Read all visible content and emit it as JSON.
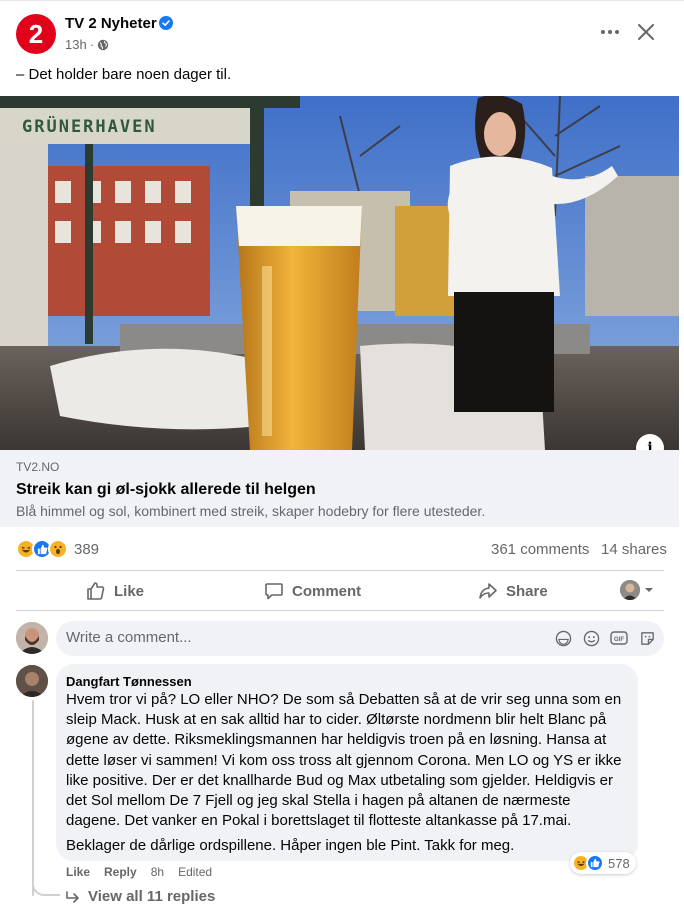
{
  "post": {
    "page_name": "TV 2 Nyheter",
    "logo_text": "2",
    "time": "13h",
    "meta_separator": "·",
    "text": "– Det holder bare noen dager til.",
    "image": {
      "sign_text": "GRÜNERHAVEN"
    },
    "link": {
      "domain": "TV2.NO",
      "title": "Streik kan gi øl-sjokk allerede til helgen",
      "description": "Blå himmel og sol, kombinert med streik, skaper hodebry for flere utesteder."
    },
    "reactions": {
      "types": [
        "haha-icon",
        "like-icon",
        "wow-icon"
      ],
      "count": "389",
      "comments": "361 comments",
      "shares": "14 shares"
    },
    "actions": {
      "like": "Like",
      "comment": "Comment",
      "share": "Share"
    }
  },
  "composer": {
    "placeholder": "Write a comment..."
  },
  "comment": {
    "author": "Dangfart Tønnessen",
    "body": "Hvem tror vi på? LO eller NHO? De som så Debatten så at de vrir seg unna som en sleip Mack. Husk at en sak alltid har to cider. Øltørste nordmenn blir helt Blanc på øgene av dette. Riksmeklingsmannen har heldigvis troen på en løsning. Hansa at dette løser vi sammen! Vi kom oss tross alt gjennom Corona. Men LO og YS er ikke like positive. Der er det knallharde Bud og Max utbetaling som gjelder. Heldigvis er det Sol mellom De 7 Fjell og jeg skal Stella i hagen på altanen de nærmeste dagene. Det vanker en Pokal i borettslaget til flotteste altankasse på 17.mai.",
    "body2": "Beklager de dårlige ordspillene. Håper ingen ble Pint. Takk for meg.",
    "reaction_count": "578",
    "like": "Like",
    "reply": "Reply",
    "time": "8h",
    "edited": "Edited",
    "view_replies": "View all 11 replies"
  },
  "colors": {
    "brand_red": "#e2001a",
    "facebook_blue": "#1877f2",
    "secondary_text": "#65676b",
    "bubble_bg": "#f0f2f5"
  }
}
